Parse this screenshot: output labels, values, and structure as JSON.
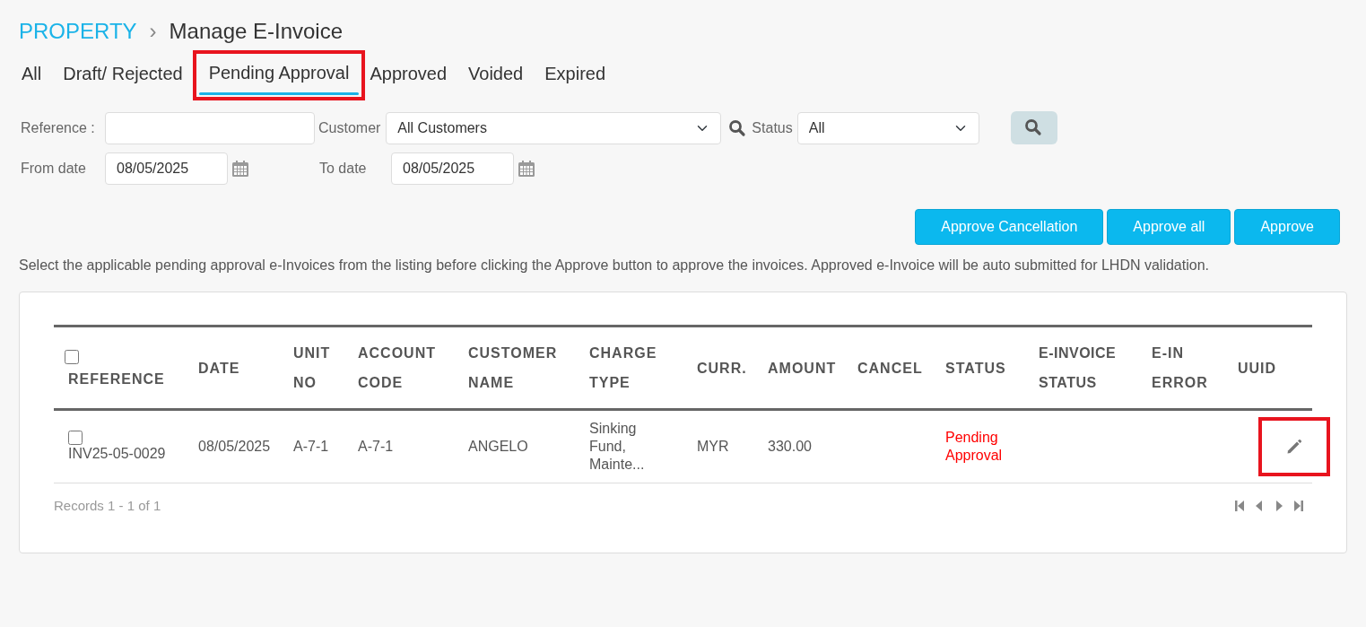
{
  "breadcrumb": {
    "root": "PROPERTY",
    "separator": "›",
    "current": "Manage E-Invoice"
  },
  "tabs": [
    {
      "label": "All",
      "selected": false,
      "highlighted": false
    },
    {
      "label": "Draft/ Rejected",
      "selected": false,
      "highlighted": false
    },
    {
      "label": "Pending Approval",
      "selected": true,
      "highlighted": true
    },
    {
      "label": "Approved",
      "selected": false,
      "highlighted": false
    },
    {
      "label": "Voided",
      "selected": false,
      "highlighted": false
    },
    {
      "label": "Expired",
      "selected": false,
      "highlighted": false
    }
  ],
  "filters": {
    "reference_label": "Reference :",
    "customer_label": "Customer",
    "customer_value": "All Customers",
    "status_label": "Status",
    "status_value": "All",
    "from_label": "From date",
    "from_value": "08/05/2025",
    "to_label": "To date",
    "to_value": "08/05/2025"
  },
  "actions": [
    "Approve Cancellation",
    "Approve all",
    "Approve"
  ],
  "instructions": "Select the applicable pending approval e-Invoices from the listing before clicking the Approve button to approve the invoices. Approved e-Invoice will be auto submitted for LHDN validation.",
  "table": {
    "select_all_checked": false,
    "columns": [
      "REFERENCE",
      "DATE",
      "UNIT NO",
      "ACCOUNT CODE",
      "CUSTOMER NAME",
      "CHARGE TYPE",
      "CURR.",
      "AMOUNT",
      "CANCEL",
      "STATUS",
      "E-INVOICE STATUS",
      "E-IN ERROR",
      "UUID"
    ],
    "rows": [
      {
        "checked": false,
        "reference": "INV25-05-0029",
        "date": "08/05/2025",
        "unit_no": "A-7-1",
        "account_code": "A-7-1",
        "customer_name": "ANGELO",
        "charge_type": "Sinking Fund, Mainte...",
        "currency": "MYR",
        "amount": "330.00",
        "status": "Pending Approval",
        "edit_highlighted": true
      }
    ]
  },
  "records": "Records 1 - 1 of 1"
}
